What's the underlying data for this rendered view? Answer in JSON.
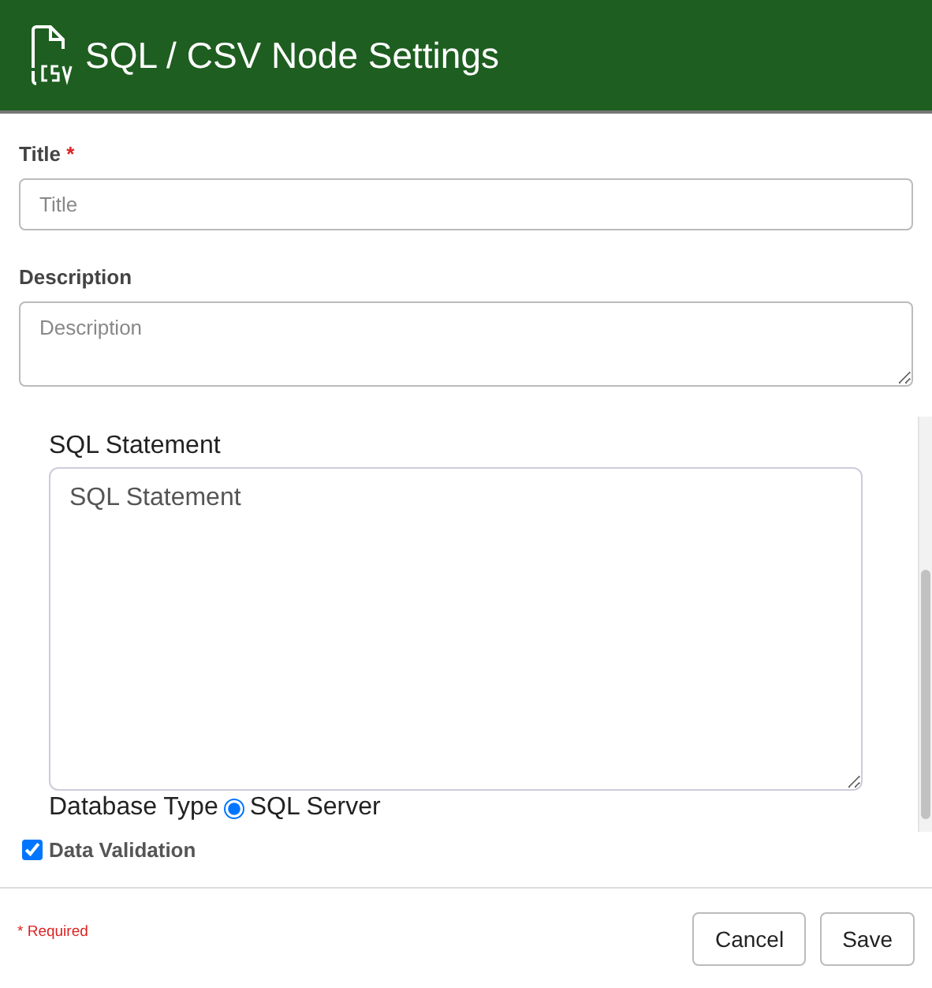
{
  "window": {
    "title": "SQL / CSV Node Settings"
  },
  "fields": [
    {
      "label": "Title",
      "required": true,
      "required_mark": "*",
      "placeholder": "Title",
      "kind": "input"
    },
    {
      "label": "Description",
      "placeholder": "Description",
      "kind": "textarea"
    }
  ],
  "sql_panel": {
    "label": "SQL Statement",
    "placeholder": "SQL Statement",
    "database_type": {
      "label": "Database Type",
      "options": [
        {
          "label": "SQL Server",
          "selected": true
        }
      ]
    }
  },
  "data_validation": {
    "label": "Data Validation",
    "checked": true
  },
  "footer": {
    "required_mark": "*",
    "required_note": "Required",
    "buttons": [
      "Cancel",
      "Save"
    ]
  }
}
